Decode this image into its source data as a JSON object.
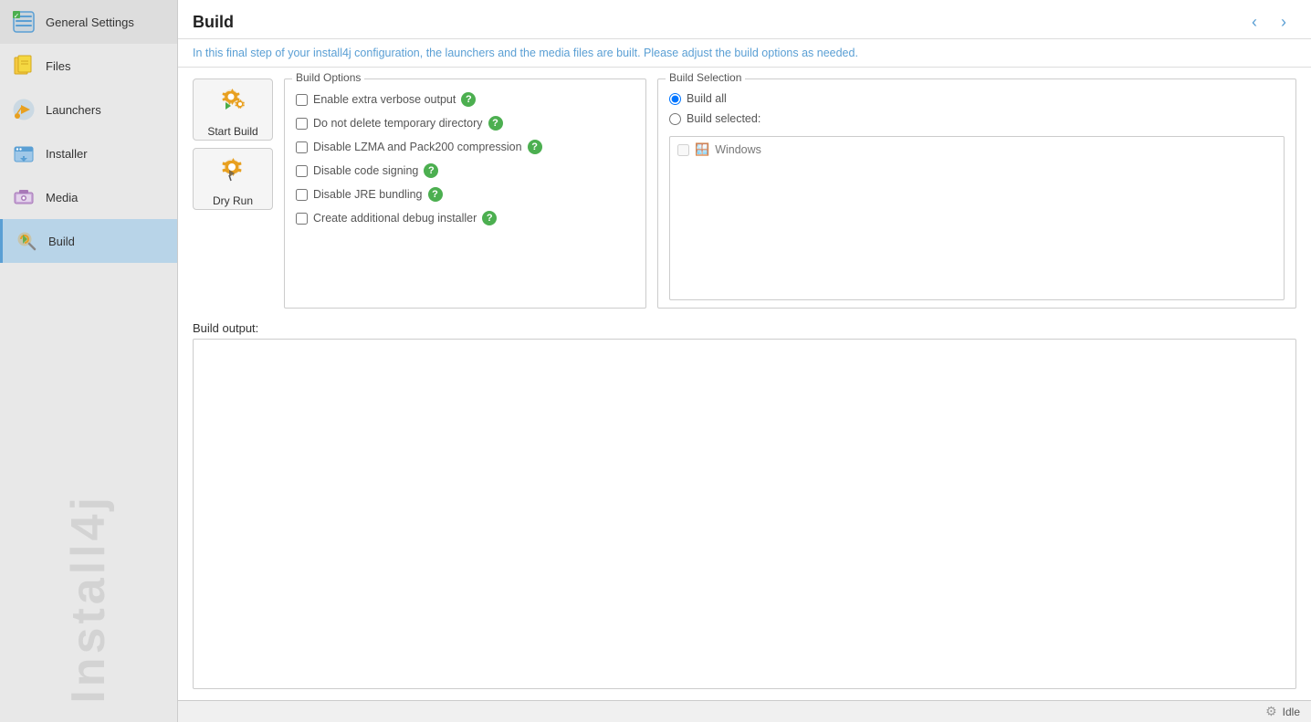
{
  "sidebar": {
    "items": [
      {
        "id": "general-settings",
        "label": "General Settings",
        "active": false
      },
      {
        "id": "files",
        "label": "Files",
        "active": false
      },
      {
        "id": "launchers",
        "label": "Launchers",
        "active": false
      },
      {
        "id": "installer",
        "label": "Installer",
        "active": false
      },
      {
        "id": "media",
        "label": "Media",
        "active": false
      },
      {
        "id": "build",
        "label": "Build",
        "active": true
      }
    ],
    "watermark": "Install4j"
  },
  "header": {
    "title": "Build",
    "description": "In this final step of your install4j configuration, the launchers and the media files are built. Please adjust the build options as needed."
  },
  "build_actions": {
    "start_build_label": "Start Build",
    "dry_run_label": "Dry Run"
  },
  "build_options": {
    "panel_title": "Build Options",
    "options": [
      {
        "id": "verbose",
        "label": "Enable extra verbose output",
        "checked": false
      },
      {
        "id": "no-delete-temp",
        "label": "Do not delete temporary directory",
        "checked": false
      },
      {
        "id": "disable-lzma",
        "label": "Disable LZMA and Pack200 compression",
        "checked": false
      },
      {
        "id": "disable-signing",
        "label": "Disable code signing",
        "checked": false
      },
      {
        "id": "disable-jre",
        "label": "Disable JRE bundling",
        "checked": false
      },
      {
        "id": "debug-installer",
        "label": "Create additional debug installer",
        "checked": false
      }
    ]
  },
  "build_selection": {
    "panel_title": "Build Selection",
    "options": [
      {
        "id": "build-all",
        "label": "Build all",
        "checked": true
      },
      {
        "id": "build-selected",
        "label": "Build selected:",
        "checked": false
      }
    ],
    "platforms": [
      {
        "id": "windows",
        "label": "Windows",
        "checked": false
      }
    ]
  },
  "build_output": {
    "label": "Build output:"
  },
  "status_bar": {
    "status": "Idle"
  },
  "nav": {
    "back_label": "‹",
    "forward_label": "›"
  }
}
